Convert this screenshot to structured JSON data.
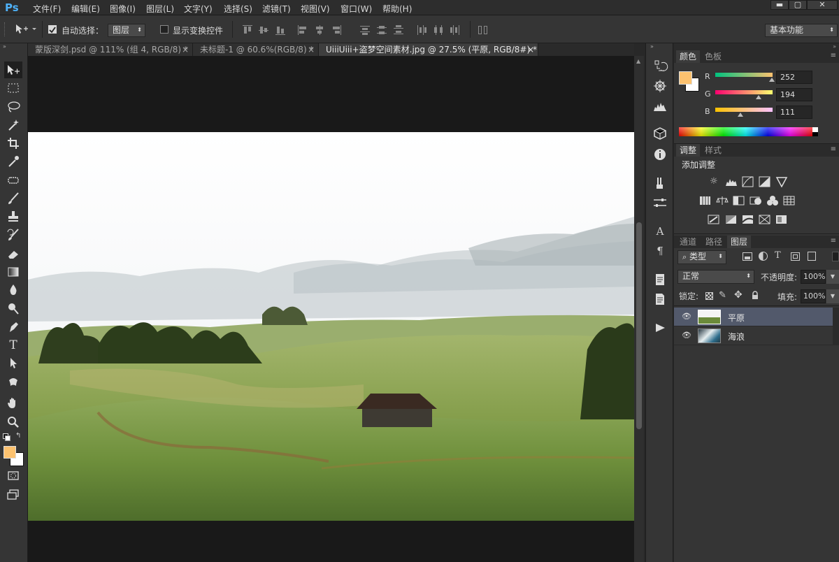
{
  "app": {
    "logo": "Ps"
  },
  "menu": [
    "文件(F)",
    "编辑(E)",
    "图像(I)",
    "图层(L)",
    "文字(Y)",
    "选择(S)",
    "滤镜(T)",
    "视图(V)",
    "窗口(W)",
    "帮助(H)"
  ],
  "window_controls": {
    "minimize": "▬",
    "maximize": "▢",
    "close": "✕"
  },
  "options": {
    "auto_select_label": "自动选择：",
    "auto_select_checked": true,
    "auto_select_target": "图层",
    "show_transform_label": "显示变换控件",
    "show_transform_checked": false,
    "workspace": "基本功能"
  },
  "tabs": [
    {
      "label": "蒙版深剑.psd @ 111% (组 4, RGB/8) *",
      "close": "×",
      "active": false
    },
    {
      "label": "未标题-1 @ 60.6%(RGB/8) *",
      "close": "×",
      "active": false
    },
    {
      "label": "UiiiUiii+盗梦空间素材.jpg @ 27.5% (平原, RGB/8#) *",
      "close": "×",
      "active": true
    }
  ],
  "tools": [
    "move-tool",
    "marquee-tool",
    "lasso-tool",
    "magic-wand-tool",
    "crop-tool",
    "eyedropper-tool",
    "healing-brush-tool",
    "brush-tool",
    "clone-stamp-tool",
    "history-brush-tool",
    "eraser-tool",
    "gradient-tool",
    "blur-tool",
    "dodge-tool",
    "pen-tool",
    "type-tool",
    "path-selection-tool",
    "shape-tool",
    "hand-tool",
    "zoom-tool"
  ],
  "type_tool_glyph": "T",
  "colors": {
    "foreground": "#fcc26f",
    "background": "#ffffff",
    "accent_selected_layer": "#52596b"
  },
  "color_panel": {
    "tabs": [
      "颜色",
      "色板"
    ],
    "channels": [
      {
        "label": "R",
        "value": "252",
        "fraction": 0.988
      },
      {
        "label": "G",
        "value": "194",
        "fraction": 0.761
      },
      {
        "label": "B",
        "value": "111",
        "fraction": 0.435
      }
    ]
  },
  "adjust_panel": {
    "tabs": [
      "调整",
      "样式"
    ],
    "title": "添加调整"
  },
  "layers_panel": {
    "tabs": [
      "通道",
      "路径",
      "图层"
    ],
    "filter_kind": "类型",
    "blend_mode": "正常",
    "opacity_label": "不透明度:",
    "opacity_value": "100%",
    "lock_label": "锁定:",
    "fill_label": "填充:",
    "fill_value": "100%",
    "layers": [
      {
        "name": "平原",
        "selected": true,
        "visible": true
      },
      {
        "name": "海浪",
        "selected": false,
        "visible": true
      }
    ]
  },
  "side_icons": [
    "history-icon",
    "navigator-icon",
    "histogram-icon",
    "3d-icon",
    "info-icon",
    "brush-preset-icon",
    "properties-icon",
    "character-icon",
    "paragraph-icon",
    "notes-icon",
    "layer-comps-icon",
    "actions-play-icon"
  ],
  "character_glyph": "A",
  "paragraph_glyph": "¶"
}
